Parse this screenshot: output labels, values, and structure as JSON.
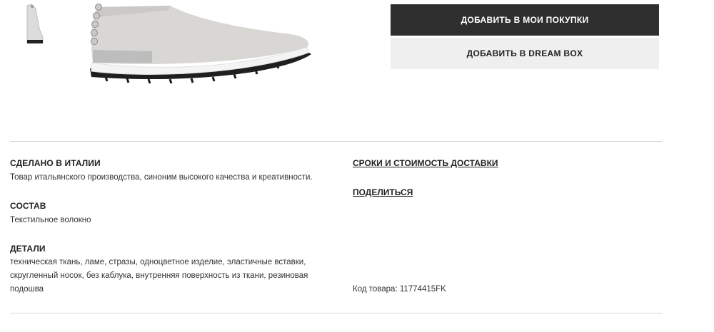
{
  "actions": {
    "add_to_cart_label": "ДОБАВИТЬ В МОИ ПОКУПКИ",
    "add_to_dreambox_label": "ДОБАВИТЬ В DREAM BOX"
  },
  "details": {
    "made_in": {
      "title": "СДЕЛАНО В ИТАЛИИ",
      "text": "Товар итальянского производства, синоним высокого качества и креативности."
    },
    "composition": {
      "title": "СОСТАВ",
      "text": "Текстильное волокно"
    },
    "details": {
      "title": "ДЕТАЛИ",
      "lines": [
        "техническая ткань, ламе, стразы, одноцветное изделие, эластичные вставки,",
        "скругленный носок, без каблука, внутренняя поверхность из ткани, резиновая",
        "подошва"
      ]
    }
  },
  "links": {
    "delivery": "СРОКИ И СТОИМОСТЬ ДОСТАВКИ",
    "share": "ПОДЕЛИТЬСЯ"
  },
  "product": {
    "code_text": "Код товара: 11774415FK"
  }
}
